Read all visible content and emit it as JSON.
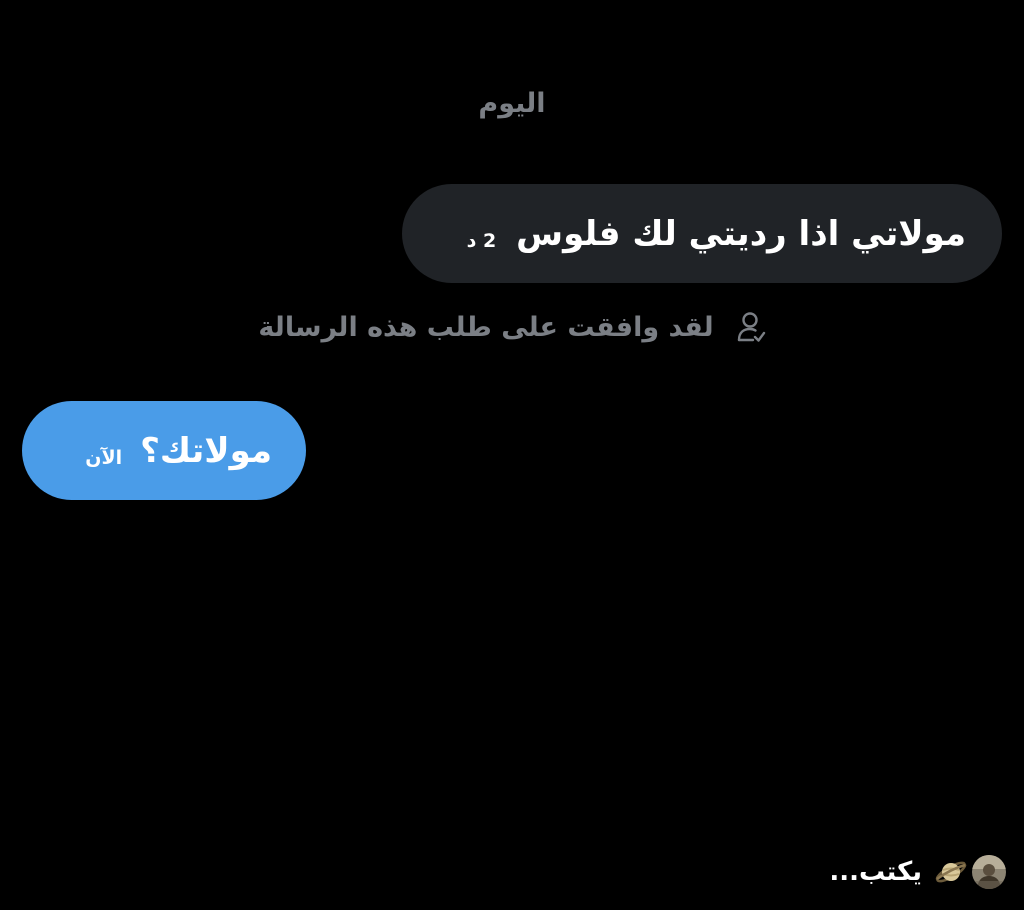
{
  "conversation": {
    "date_separator": "اليوم",
    "messages": [
      {
        "direction": "incoming",
        "text": "مولاتي اذا رديتي لك فلوس",
        "time": "2 د"
      },
      {
        "direction": "outgoing",
        "text": "مولاتك؟",
        "time": "الآن"
      }
    ],
    "request_notice": {
      "text": "لقد وافقت على طلب هذه الرسالة",
      "icon": "user-check-icon"
    },
    "typing_indicator": {
      "text": "يكتب...",
      "avatars": [
        "saturn-avatar",
        "profile-avatar"
      ]
    }
  },
  "colors": {
    "background": "#000000",
    "incoming_bubble": "#202327",
    "outgoing_bubble": "#4a9ce8",
    "muted_text": "#7b7f85"
  }
}
